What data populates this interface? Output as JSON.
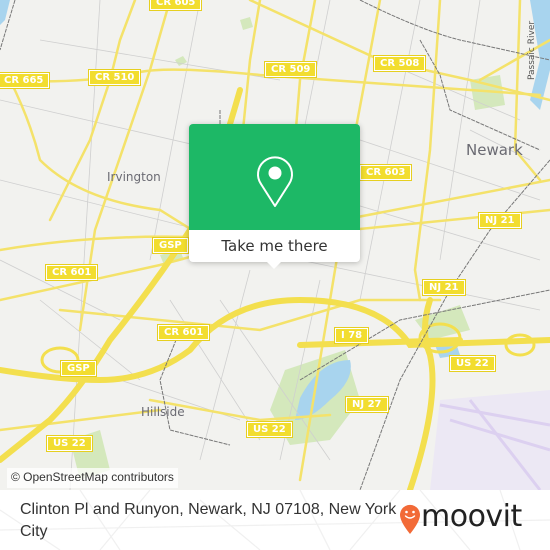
{
  "map": {
    "provider_attribution": "© OpenStreetMap contributors",
    "road_shields": [
      {
        "label": "CR 605"
      },
      {
        "label": "CR 665"
      },
      {
        "label": "CR 510"
      },
      {
        "label": "CR 509"
      },
      {
        "label": "CR 508"
      },
      {
        "label": "CR 603"
      },
      {
        "label": "GSP"
      },
      {
        "label": "CR 601"
      },
      {
        "label": "CR 601"
      },
      {
        "label": "GSP"
      },
      {
        "label": "US 22"
      },
      {
        "label": "NJ 21"
      },
      {
        "label": "NJ 21"
      },
      {
        "label": "I 78"
      },
      {
        "label": "US 22"
      },
      {
        "label": "NJ 27"
      },
      {
        "label": "US 22"
      }
    ],
    "places": {
      "newark": "Newark",
      "irvington": "Irvington",
      "hillside": "Hillside",
      "river": "Passaic River"
    },
    "colors": {
      "land": "#f2f2ef",
      "road_major": "#f4e26a",
      "road_minor": "#c9c9c9",
      "water": "#a8d4ee",
      "park": "#cfe7b4",
      "rail": "#707070",
      "airport": "#e3dcf2"
    }
  },
  "popup": {
    "icon": "map-pin-icon",
    "cta_label": "Take me there",
    "accent": "#1db866"
  },
  "footer": {
    "address": "Clinton Pl and Runyon, Newark, NJ 07108, New York City",
    "brand_name": "moovit",
    "brand_color": "#f26a37"
  }
}
